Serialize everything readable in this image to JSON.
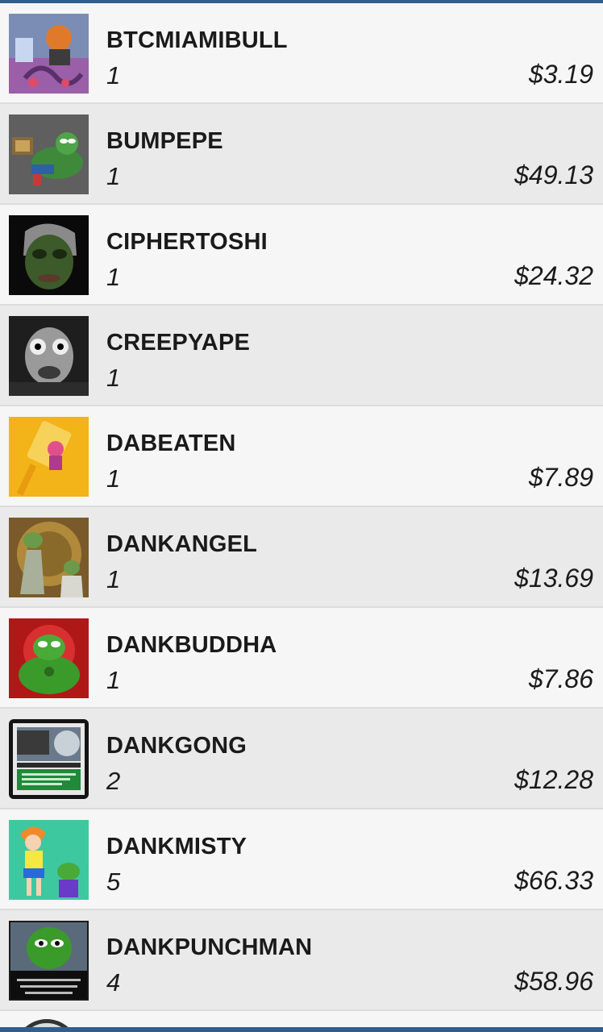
{
  "assets": [
    {
      "name": "BTCMIAMIBULL",
      "quantity": "1",
      "price": "$3.19",
      "thumb_icon": "bull-robot-art-icon"
    },
    {
      "name": "BUMPEPE",
      "quantity": "1",
      "price": "$49.13",
      "thumb_icon": "pepe-lying-art-icon"
    },
    {
      "name": "CIPHERTOSHI",
      "quantity": "1",
      "price": "$24.32",
      "thumb_icon": "green-face-portrait-icon"
    },
    {
      "name": "CREEPYAPE",
      "quantity": "1",
      "price": "",
      "thumb_icon": "creepy-ape-face-icon"
    },
    {
      "name": "DABEATEN",
      "quantity": "1",
      "price": "$7.89",
      "thumb_icon": "fly-swatter-art-icon"
    },
    {
      "name": "DANKANGEL",
      "quantity": "1",
      "price": "$13.69",
      "thumb_icon": "pepe-angel-art-icon"
    },
    {
      "name": "DANKBUDDHA",
      "quantity": "1",
      "price": "$7.86",
      "thumb_icon": "pepe-buddha-art-icon"
    },
    {
      "name": "DANKGONG",
      "quantity": "2",
      "price": "$12.28",
      "thumb_icon": "dankgong-card-icon"
    },
    {
      "name": "DANKMISTY",
      "quantity": "5",
      "price": "$66.33",
      "thumb_icon": "misty-pepe-art-icon"
    },
    {
      "name": "DANKPUNCHMAN",
      "quantity": "4",
      "price": "$58.96",
      "thumb_icon": "punchman-pepe-art-icon"
    }
  ],
  "colors": {
    "accent_bar": "#2f5f8f",
    "row_light": "#f6f6f6",
    "row_dark": "#eaeaea"
  }
}
